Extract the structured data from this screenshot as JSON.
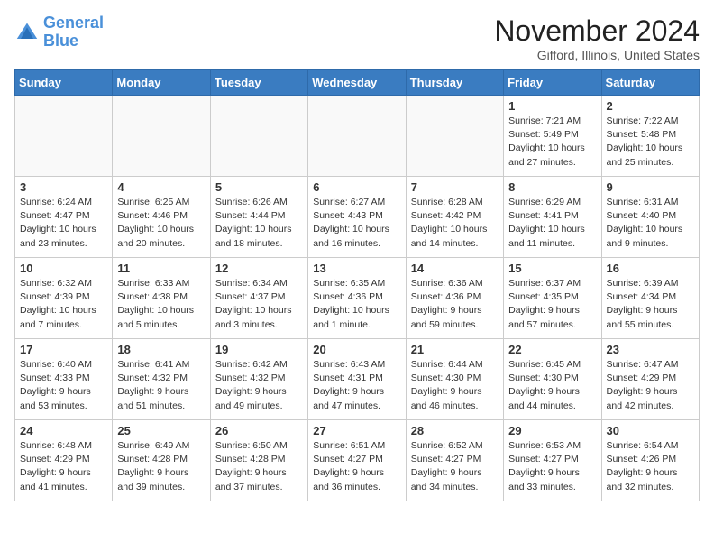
{
  "logo": {
    "line1": "General",
    "line2": "Blue"
  },
  "title": "November 2024",
  "location": "Gifford, Illinois, United States",
  "weekdays": [
    "Sunday",
    "Monday",
    "Tuesday",
    "Wednesday",
    "Thursday",
    "Friday",
    "Saturday"
  ],
  "weeks": [
    [
      {
        "day": "",
        "info": ""
      },
      {
        "day": "",
        "info": ""
      },
      {
        "day": "",
        "info": ""
      },
      {
        "day": "",
        "info": ""
      },
      {
        "day": "",
        "info": ""
      },
      {
        "day": "1",
        "info": "Sunrise: 7:21 AM\nSunset: 5:49 PM\nDaylight: 10 hours\nand 27 minutes."
      },
      {
        "day": "2",
        "info": "Sunrise: 7:22 AM\nSunset: 5:48 PM\nDaylight: 10 hours\nand 25 minutes."
      }
    ],
    [
      {
        "day": "3",
        "info": "Sunrise: 6:24 AM\nSunset: 4:47 PM\nDaylight: 10 hours\nand 23 minutes."
      },
      {
        "day": "4",
        "info": "Sunrise: 6:25 AM\nSunset: 4:46 PM\nDaylight: 10 hours\nand 20 minutes."
      },
      {
        "day": "5",
        "info": "Sunrise: 6:26 AM\nSunset: 4:44 PM\nDaylight: 10 hours\nand 18 minutes."
      },
      {
        "day": "6",
        "info": "Sunrise: 6:27 AM\nSunset: 4:43 PM\nDaylight: 10 hours\nand 16 minutes."
      },
      {
        "day": "7",
        "info": "Sunrise: 6:28 AM\nSunset: 4:42 PM\nDaylight: 10 hours\nand 14 minutes."
      },
      {
        "day": "8",
        "info": "Sunrise: 6:29 AM\nSunset: 4:41 PM\nDaylight: 10 hours\nand 11 minutes."
      },
      {
        "day": "9",
        "info": "Sunrise: 6:31 AM\nSunset: 4:40 PM\nDaylight: 10 hours\nand 9 minutes."
      }
    ],
    [
      {
        "day": "10",
        "info": "Sunrise: 6:32 AM\nSunset: 4:39 PM\nDaylight: 10 hours\nand 7 minutes."
      },
      {
        "day": "11",
        "info": "Sunrise: 6:33 AM\nSunset: 4:38 PM\nDaylight: 10 hours\nand 5 minutes."
      },
      {
        "day": "12",
        "info": "Sunrise: 6:34 AM\nSunset: 4:37 PM\nDaylight: 10 hours\nand 3 minutes."
      },
      {
        "day": "13",
        "info": "Sunrise: 6:35 AM\nSunset: 4:36 PM\nDaylight: 10 hours\nand 1 minute."
      },
      {
        "day": "14",
        "info": "Sunrise: 6:36 AM\nSunset: 4:36 PM\nDaylight: 9 hours\nand 59 minutes."
      },
      {
        "day": "15",
        "info": "Sunrise: 6:37 AM\nSunset: 4:35 PM\nDaylight: 9 hours\nand 57 minutes."
      },
      {
        "day": "16",
        "info": "Sunrise: 6:39 AM\nSunset: 4:34 PM\nDaylight: 9 hours\nand 55 minutes."
      }
    ],
    [
      {
        "day": "17",
        "info": "Sunrise: 6:40 AM\nSunset: 4:33 PM\nDaylight: 9 hours\nand 53 minutes."
      },
      {
        "day": "18",
        "info": "Sunrise: 6:41 AM\nSunset: 4:32 PM\nDaylight: 9 hours\nand 51 minutes."
      },
      {
        "day": "19",
        "info": "Sunrise: 6:42 AM\nSunset: 4:32 PM\nDaylight: 9 hours\nand 49 minutes."
      },
      {
        "day": "20",
        "info": "Sunrise: 6:43 AM\nSunset: 4:31 PM\nDaylight: 9 hours\nand 47 minutes."
      },
      {
        "day": "21",
        "info": "Sunrise: 6:44 AM\nSunset: 4:30 PM\nDaylight: 9 hours\nand 46 minutes."
      },
      {
        "day": "22",
        "info": "Sunrise: 6:45 AM\nSunset: 4:30 PM\nDaylight: 9 hours\nand 44 minutes."
      },
      {
        "day": "23",
        "info": "Sunrise: 6:47 AM\nSunset: 4:29 PM\nDaylight: 9 hours\nand 42 minutes."
      }
    ],
    [
      {
        "day": "24",
        "info": "Sunrise: 6:48 AM\nSunset: 4:29 PM\nDaylight: 9 hours\nand 41 minutes."
      },
      {
        "day": "25",
        "info": "Sunrise: 6:49 AM\nSunset: 4:28 PM\nDaylight: 9 hours\nand 39 minutes."
      },
      {
        "day": "26",
        "info": "Sunrise: 6:50 AM\nSunset: 4:28 PM\nDaylight: 9 hours\nand 37 minutes."
      },
      {
        "day": "27",
        "info": "Sunrise: 6:51 AM\nSunset: 4:27 PM\nDaylight: 9 hours\nand 36 minutes."
      },
      {
        "day": "28",
        "info": "Sunrise: 6:52 AM\nSunset: 4:27 PM\nDaylight: 9 hours\nand 34 minutes."
      },
      {
        "day": "29",
        "info": "Sunrise: 6:53 AM\nSunset: 4:27 PM\nDaylight: 9 hours\nand 33 minutes."
      },
      {
        "day": "30",
        "info": "Sunrise: 6:54 AM\nSunset: 4:26 PM\nDaylight: 9 hours\nand 32 minutes."
      }
    ]
  ]
}
